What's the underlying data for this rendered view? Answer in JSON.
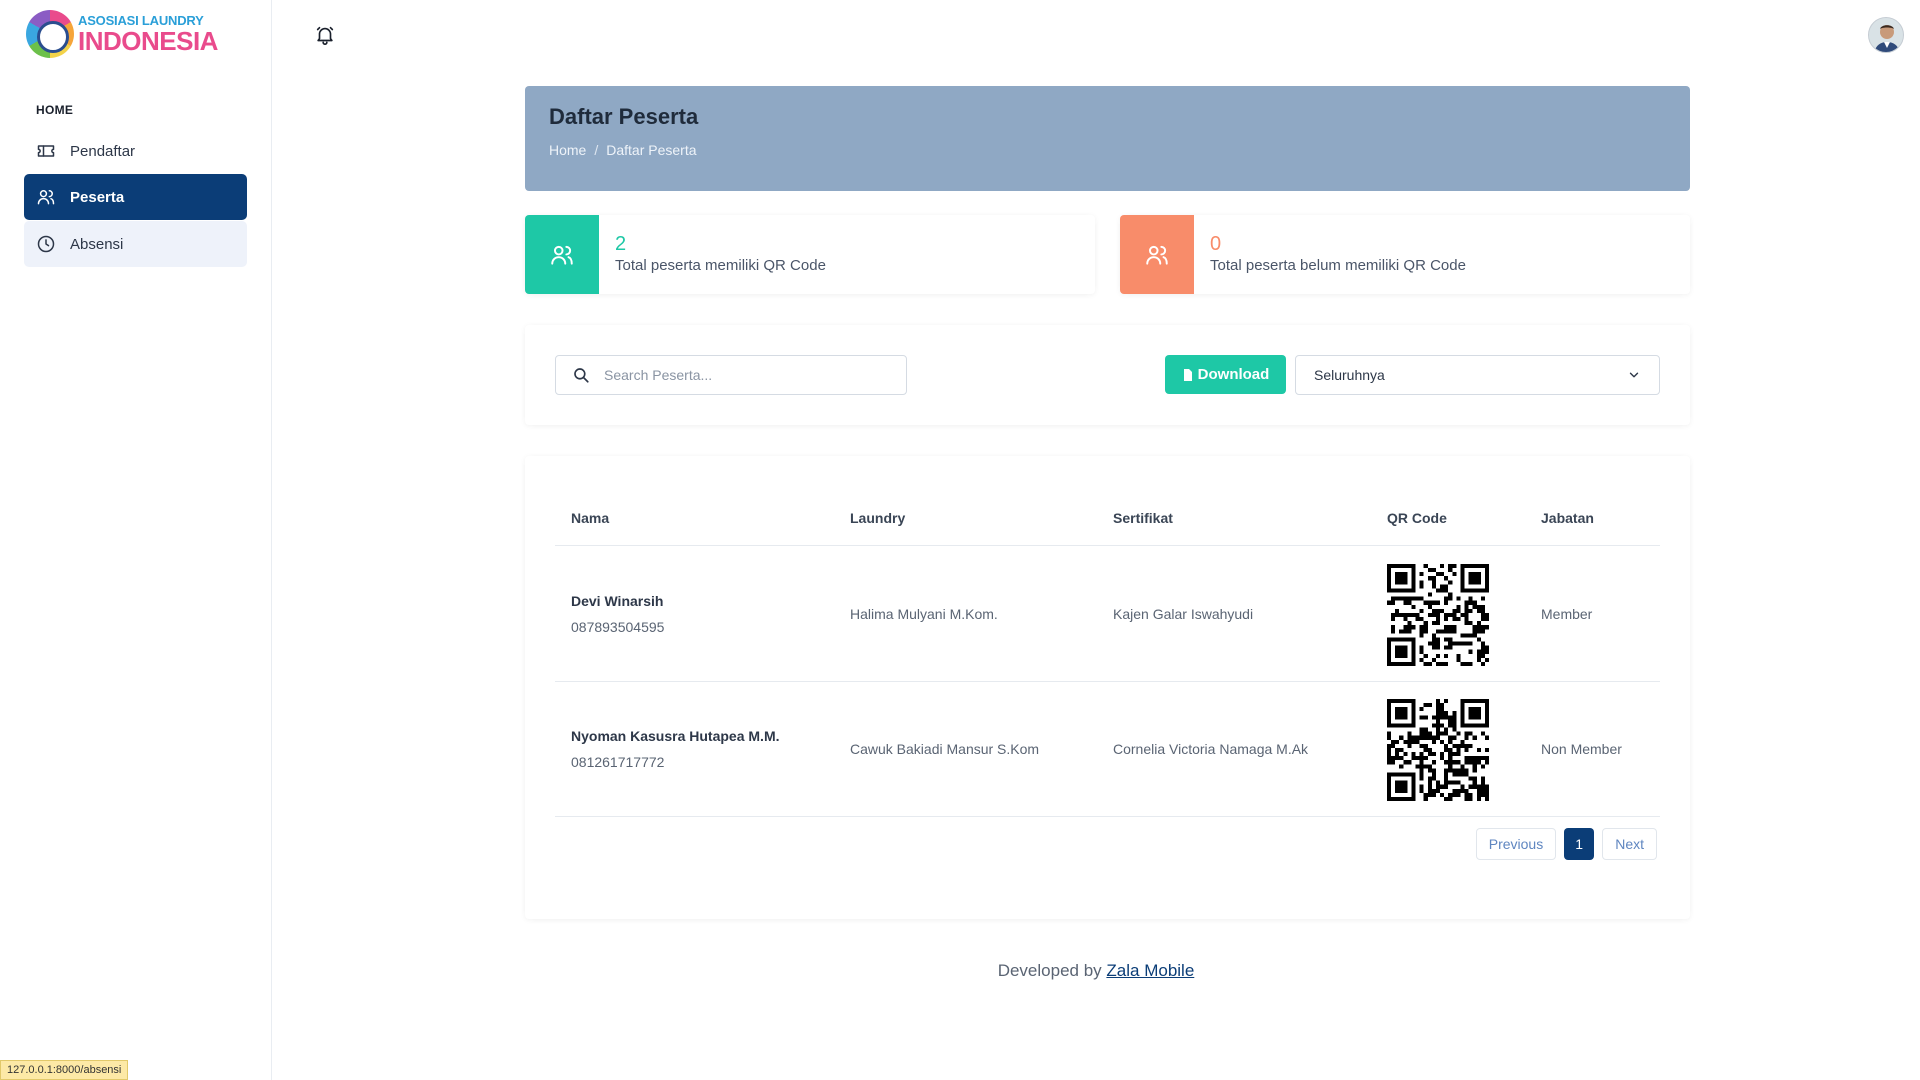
{
  "brand": {
    "line1": "ASOSIASI LAUNDRY",
    "line2": "INDONESIA"
  },
  "sidebar": {
    "section": "HOME",
    "items": [
      {
        "label": "Pendaftar",
        "icon": "ticket-icon"
      },
      {
        "label": "Peserta",
        "icon": "users-icon",
        "active": true
      },
      {
        "label": "Absensi",
        "icon": "clock-icon"
      }
    ]
  },
  "status_url": "127.0.0.1:8000/absensi",
  "header": {
    "title": "Daftar Peserta",
    "breadcrumb": [
      "Home",
      "/",
      "Daftar Peserta"
    ]
  },
  "stats": [
    {
      "value": "2",
      "label": "Total peserta memiliki QR Code",
      "color": "#1ec8a6"
    },
    {
      "value": "0",
      "label": "Total peserta belum memiliki QR Code",
      "color": "#f88c6a"
    }
  ],
  "toolbar": {
    "search_placeholder": "Search Peserta...",
    "download_label": "Download",
    "filter_value": "Seluruhnya"
  },
  "table": {
    "columns": [
      "Nama",
      "Laundry",
      "Sertifikat",
      "QR Code",
      "Jabatan"
    ],
    "rows": [
      {
        "name": "Devi Winarsih",
        "phone": "087893504595",
        "laundry": "Halima Mulyani M.Kom.",
        "sertifikat": "Kajen Galar Iswahyudi",
        "jabatan": "Member"
      },
      {
        "name": "Nyoman Kasusra Hutapea M.M.",
        "phone": "081261717772",
        "laundry": "Cawuk Bakiadi Mansur S.Kom",
        "sertifikat": "Cornelia Victoria Namaga M.Ak",
        "jabatan": "Non Member"
      }
    ]
  },
  "pagination": {
    "previous": "Previous",
    "current": "1",
    "next": "Next"
  },
  "footer": {
    "prefix": "Developed by",
    "link": "Zala Mobile"
  }
}
